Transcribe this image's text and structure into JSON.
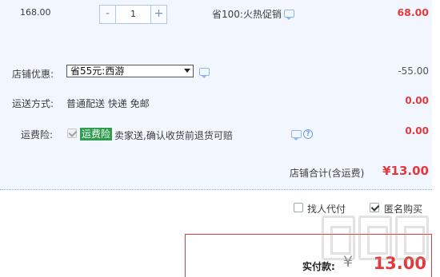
{
  "item": {
    "unit_price": "168.00",
    "qty_minus": "-",
    "qty_value": "1",
    "qty_plus": "+",
    "promo_text": "省100:火热促销",
    "item_total": "68.00"
  },
  "shop_discount": {
    "label": "店铺优惠:",
    "selected": "省55元:西游",
    "amount": "-55.00"
  },
  "shipping": {
    "label": "运送方式:",
    "method": "普通配送 快递 免邮",
    "fee": "0.00"
  },
  "insurance": {
    "label": "运费险:",
    "tag": "运费险",
    "desc": "卖家送,确认收货前退货可赔",
    "help": "?",
    "fee": "0.00"
  },
  "shop_total": {
    "label": "店铺合计(含运费)",
    "amount": "¥13.00"
  },
  "options": {
    "pay_for_me": "找人代付",
    "anonymous": "匿名购买"
  },
  "payment": {
    "label": "实付款:",
    "currency": "¥",
    "amount": "13.00"
  },
  "colors": {
    "accent_red": "#e4393c",
    "band_bg": "#f2f7ff",
    "insurance_green": "#2e9c4c"
  }
}
